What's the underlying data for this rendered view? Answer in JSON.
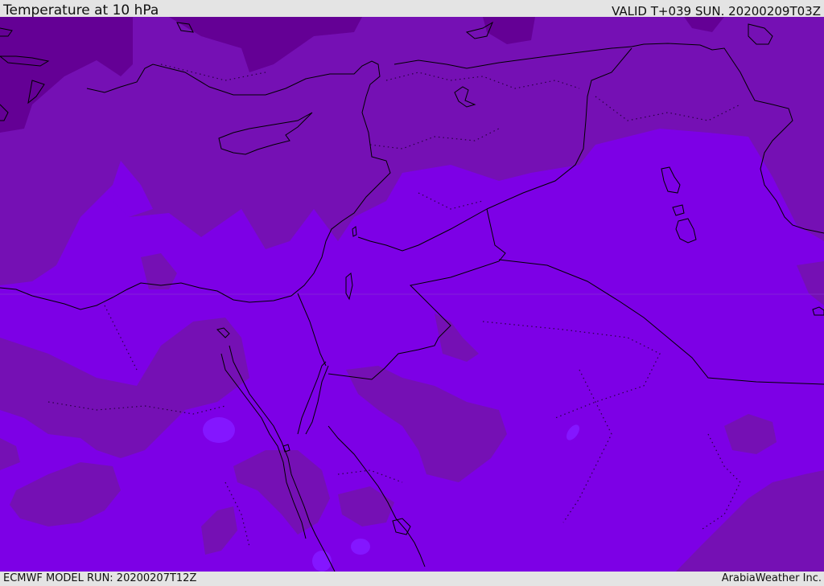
{
  "header": {
    "title": "Temperature at 10 hPa",
    "valid": "VALID T+039 SUN. 20200209T03Z"
  },
  "footer": {
    "model_run": "ECMWF MODEL RUN: 20200207T12Z",
    "credit": "ArabiaWeather Inc."
  },
  "map": {
    "colors": {
      "darkest": "#640095",
      "dark": "#7510b4",
      "mid": "#7a00d7",
      "light": "#7d00e6",
      "bright": "#8416ff",
      "coast": "#000000"
    }
  }
}
